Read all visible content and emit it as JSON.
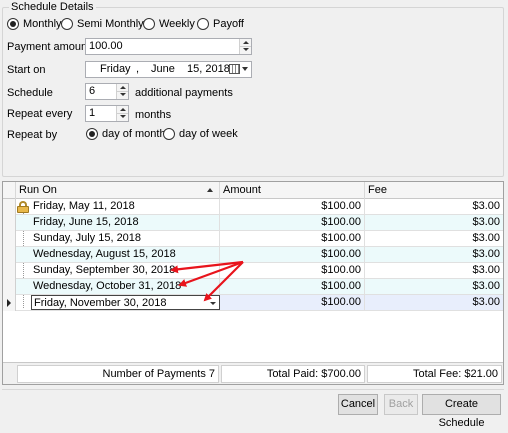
{
  "schedule": {
    "group_title": "Schedule Details",
    "frequency_options": [
      {
        "label": "Monthly",
        "checked": true
      },
      {
        "label": "Semi Monthly",
        "checked": false
      },
      {
        "label": "Weekly",
        "checked": false
      },
      {
        "label": "Payoff",
        "checked": false
      }
    ],
    "payment_amount_label": "Payment amount",
    "payment_amount_value": "100.00",
    "start_on_label": "Start on",
    "start_on": {
      "weekday": "Friday",
      "sep": ",",
      "month": "June",
      "day_year": "15, 2018"
    },
    "schedule_label": "Schedule",
    "schedule_value": "6",
    "schedule_suffix": "additional payments",
    "repeat_every_label": "Repeat every",
    "repeat_every_value": "1",
    "repeat_every_suffix": "months",
    "repeat_by_label": "Repeat by",
    "repeat_by_options": [
      {
        "label": "day of month",
        "checked": true
      },
      {
        "label": "day of week",
        "checked": false
      }
    ]
  },
  "grid": {
    "columns": [
      "Run On",
      "Amount",
      "Fee"
    ],
    "rows": [
      {
        "run_on": "Friday, May 11, 2018",
        "amount": "$100.00",
        "fee": "$3.00"
      },
      {
        "run_on": "Friday, June 15, 2018",
        "amount": "$100.00",
        "fee": "$3.00"
      },
      {
        "run_on": "Sunday, July 15, 2018",
        "amount": "$100.00",
        "fee": "$3.00"
      },
      {
        "run_on": "Wednesday, August 15, 2018",
        "amount": "$100.00",
        "fee": "$3.00"
      },
      {
        "run_on": "Sunday, September 30, 2018",
        "amount": "$100.00",
        "fee": "$3.00"
      },
      {
        "run_on": "Wednesday, October 31, 2018",
        "amount": "$100.00",
        "fee": "$3.00"
      },
      {
        "run_on": "Friday, November 30, 2018",
        "amount": "$100.00",
        "fee": "$3.00"
      }
    ],
    "footer": {
      "count": "Number of Payments 7",
      "total_paid": "Total Paid: $700.00",
      "total_fee": "Total Fee: $21.00"
    }
  },
  "buttons": {
    "cancel": "Cancel",
    "back": "Back",
    "create": "Create Schedule"
  },
  "colors": {
    "annotation_arrow": "#e8141c",
    "alt_row": "#ecfafb"
  }
}
